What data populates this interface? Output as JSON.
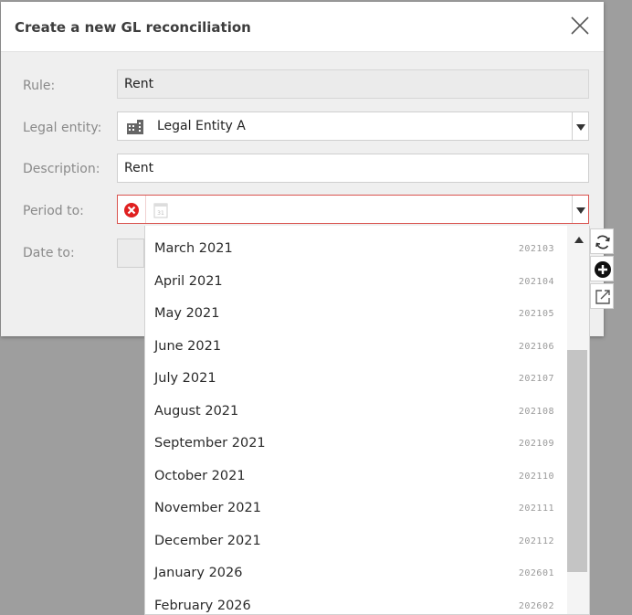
{
  "dialog": {
    "title": "Create a new GL reconciliation",
    "close_icon": "close-icon"
  },
  "form": {
    "rule": {
      "label": "Rule:",
      "value": "Rent"
    },
    "legal_entity": {
      "label": "Legal entity:",
      "value": "Legal Entity A",
      "icon": "building-icon"
    },
    "description": {
      "label": "Description:",
      "value": "Rent"
    },
    "period_to": {
      "label": "Period to:",
      "value": "",
      "error_icon": "error-icon",
      "calendar_icon": "calendar-icon"
    },
    "date_to": {
      "label": "Date to:"
    }
  },
  "side_actions": [
    {
      "name": "refresh-icon"
    },
    {
      "name": "add-icon"
    },
    {
      "name": "open-external-icon"
    }
  ],
  "period_options": [
    {
      "label": "March 2021",
      "code": "202103"
    },
    {
      "label": "April 2021",
      "code": "202104"
    },
    {
      "label": "May 2021",
      "code": "202105"
    },
    {
      "label": "June 2021",
      "code": "202106"
    },
    {
      "label": "July 2021",
      "code": "202107"
    },
    {
      "label": "August 2021",
      "code": "202108"
    },
    {
      "label": "September 2021",
      "code": "202109"
    },
    {
      "label": "October 2021",
      "code": "202110"
    },
    {
      "label": "November 2021",
      "code": "202111"
    },
    {
      "label": "December 2021",
      "code": "202112"
    },
    {
      "label": "January 2026",
      "code": "202601"
    },
    {
      "label": "February 2026",
      "code": "202602"
    }
  ],
  "colors": {
    "error": "#d9534f",
    "backdrop": "#9e9e9e"
  }
}
